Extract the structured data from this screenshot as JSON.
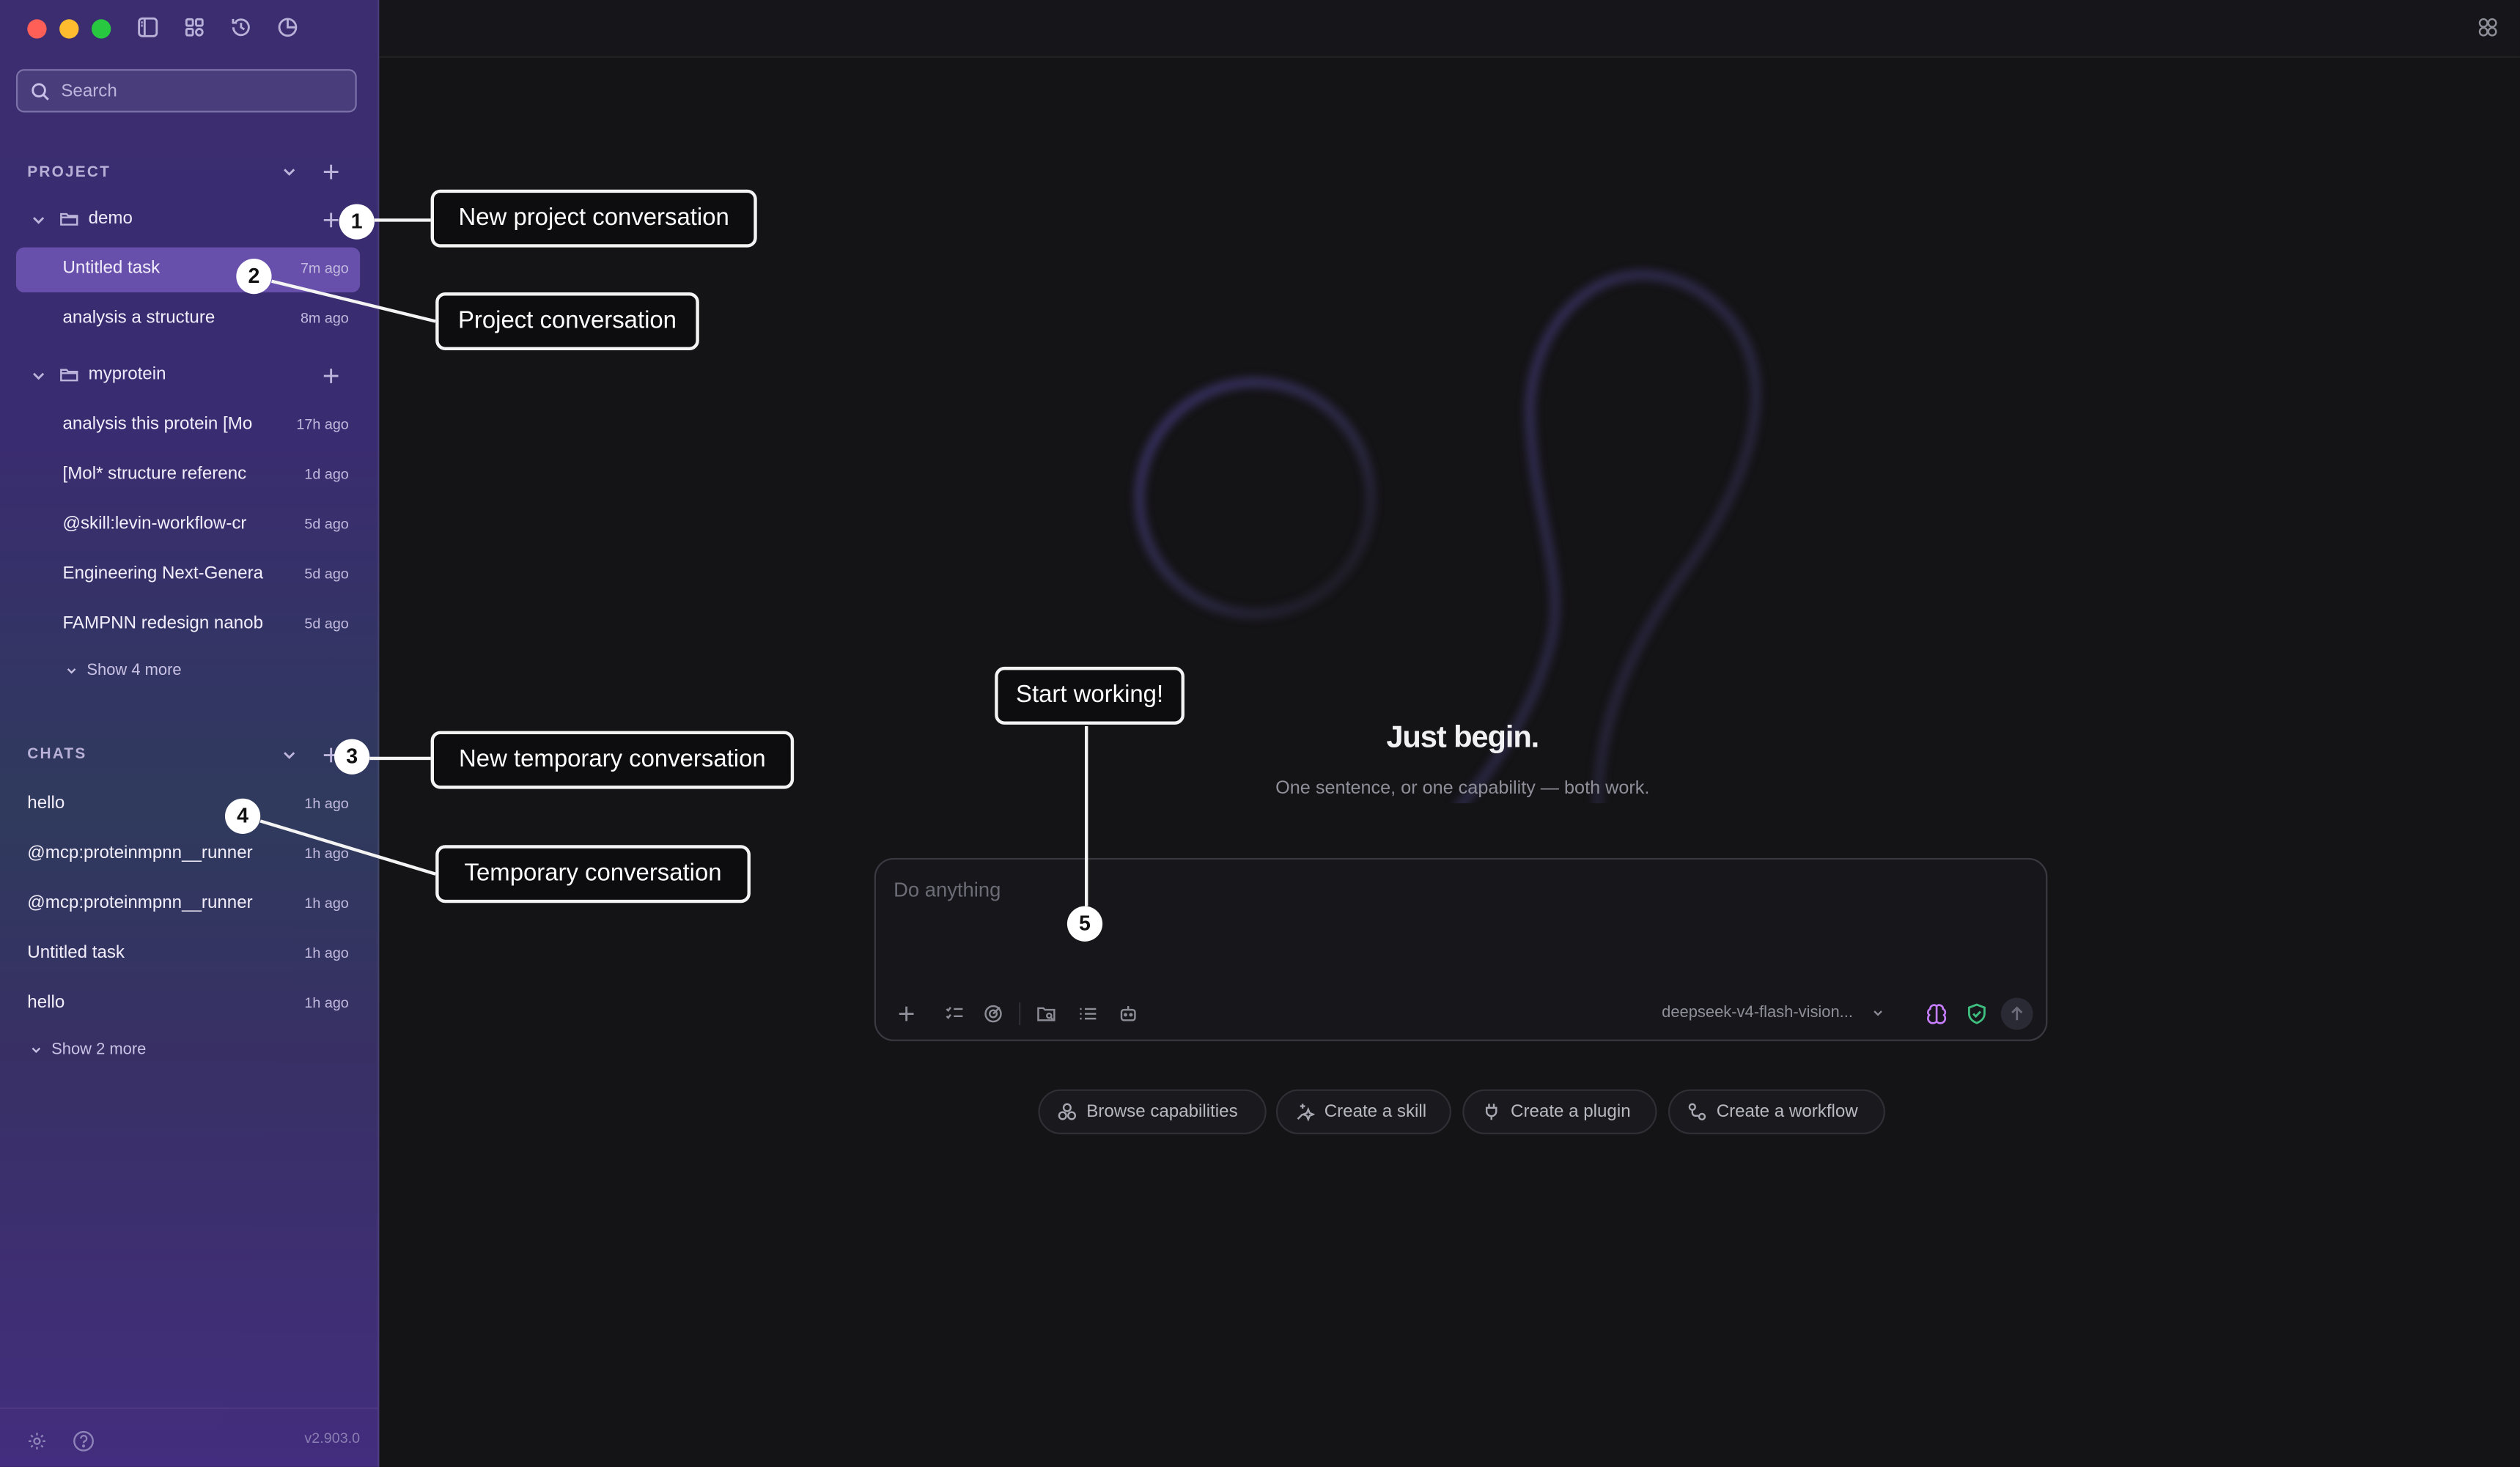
{
  "colors": {
    "traffic_red": "#ff5f57",
    "traffic_yellow": "#febc2e",
    "traffic_green": "#28c840",
    "sidebar_active": "#7a5ccc",
    "main_bg": "#141315",
    "shield_green": "#3fbf7f",
    "brain_purple": "#c77dff"
  },
  "search": {
    "placeholder": "Search"
  },
  "project": {
    "title": "PROJECT",
    "folders": [
      {
        "name": "demo",
        "items": [
          {
            "label": "Untitled task",
            "time": "7m ago"
          },
          {
            "label": "analysis a structure",
            "time": "8m ago"
          }
        ]
      },
      {
        "name": "myprotein",
        "items": [
          {
            "label": "analysis this protein [Mo",
            "time": "17h ago"
          },
          {
            "label": "[Mol* structure referenc",
            "time": "1d ago"
          },
          {
            "label": "@skill:levin-workflow-cr",
            "time": "5d ago"
          },
          {
            "label": "Engineering Next-Genera",
            "time": "5d ago"
          },
          {
            "label": "FAMPNN redesign nanob",
            "time": "5d ago"
          }
        ],
        "show_more": "Show 4 more"
      }
    ]
  },
  "chats": {
    "title": "CHATS",
    "items": [
      {
        "label": "hello",
        "time": "1h ago"
      },
      {
        "label": "@mcp:proteinmpnn__runner",
        "time": "1h ago"
      },
      {
        "label": "@mcp:proteinmpnn__runner",
        "time": "1h ago"
      },
      {
        "label": "Untitled task",
        "time": "1h ago"
      },
      {
        "label": "hello",
        "time": "1h ago"
      }
    ],
    "show_more": "Show 2 more"
  },
  "footer": {
    "version": "v2.903.0"
  },
  "main": {
    "title": "Just begin.",
    "subtitle": "One sentence, or one capability — both work.",
    "composer": {
      "placeholder": "Do anything",
      "model": "deepseek-v4-flash-vision..."
    },
    "chips": [
      {
        "label": "Browse capabilities",
        "icon": "capabilities-icon"
      },
      {
        "label": "Create a skill",
        "icon": "sparkle-icon"
      },
      {
        "label": "Create a plugin",
        "icon": "plug-icon"
      },
      {
        "label": "Create a workflow",
        "icon": "workflow-icon"
      }
    ]
  },
  "callouts": [
    {
      "badge": "1",
      "label": "New project conversation"
    },
    {
      "badge": "2",
      "label": "Project conversation"
    },
    {
      "badge": "3",
      "label": "New temporary conversation"
    },
    {
      "badge": "4",
      "label": "Temporary conversation"
    },
    {
      "badge": "5",
      "label": "Start working!"
    }
  ]
}
